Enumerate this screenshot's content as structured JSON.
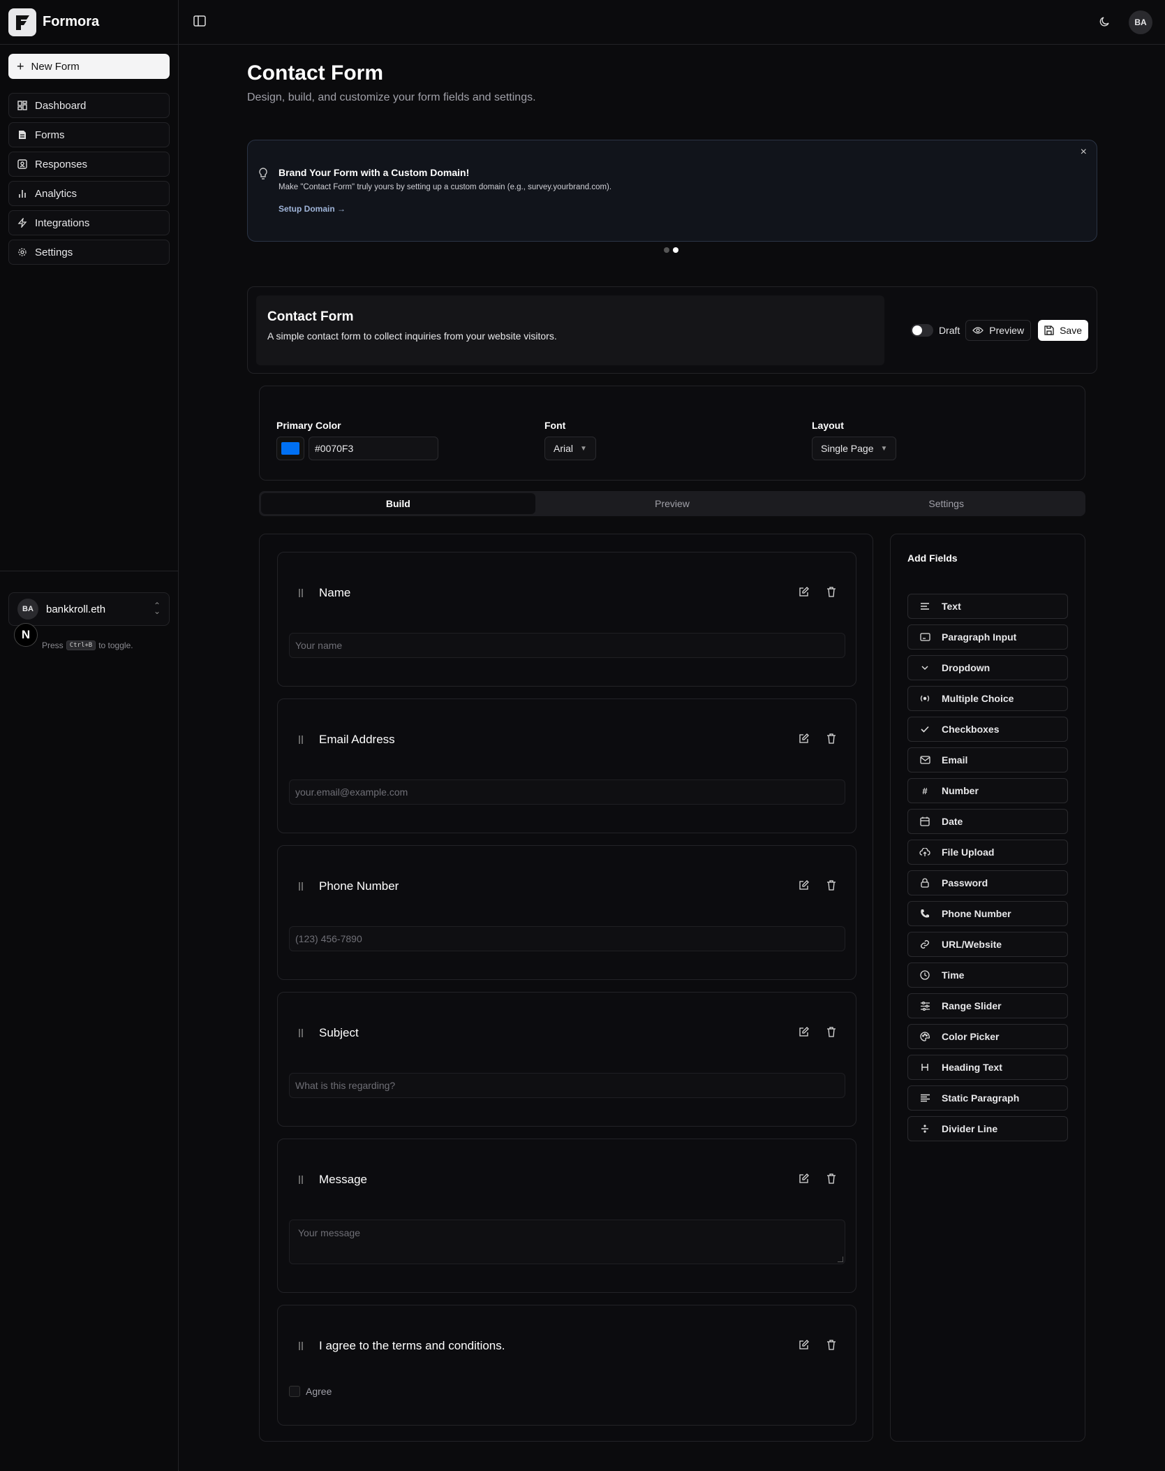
{
  "brand": {
    "name": "Formora"
  },
  "sidebar": {
    "new_form": "New Form",
    "items": [
      {
        "label": "Dashboard",
        "icon": "dashboard-icon"
      },
      {
        "label": "Forms",
        "icon": "file-icon"
      },
      {
        "label": "Responses",
        "icon": "inbox-icon"
      },
      {
        "label": "Analytics",
        "icon": "chart-icon"
      },
      {
        "label": "Integrations",
        "icon": "zap-icon"
      },
      {
        "label": "Settings",
        "icon": "gear-icon"
      }
    ],
    "user": {
      "initials": "BA",
      "name": "bankkroll.eth"
    },
    "hint": {
      "prefix": "Press",
      "key": "Ctrl+B",
      "suffix": "to toggle."
    },
    "n_badge": "N"
  },
  "topbar": {
    "avatar": "BA"
  },
  "page": {
    "title": "Contact Form",
    "subtitle": "Design, build, and customize your form fields and settings."
  },
  "banner": {
    "title": "Brand Your Form with a Custom Domain!",
    "text": "Make \"Contact Form\" truly yours by setting up a custom domain (e.g., survey.yourbrand.com).",
    "link": "Setup Domain →",
    "close": "×"
  },
  "form_header": {
    "title": "Contact Form",
    "description": "A simple contact form to collect inquiries from your website visitors.",
    "draft_label": "Draft",
    "preview_label": "Preview",
    "save_label": "Save"
  },
  "theme": {
    "primary_color_label": "Primary Color",
    "primary_color_value": "#0070F3",
    "font_label": "Font",
    "font_value": "Arial",
    "layout_label": "Layout",
    "layout_value": "Single Page"
  },
  "tabs": [
    {
      "label": "Build",
      "active": true
    },
    {
      "label": "Preview",
      "active": false
    },
    {
      "label": "Settings",
      "active": false
    }
  ],
  "fields": [
    {
      "label": "Name",
      "placeholder": "Your name"
    },
    {
      "label": "Email Address",
      "placeholder": "your.email@example.com"
    },
    {
      "label": "Phone Number",
      "placeholder": "(123) 456-7890"
    },
    {
      "label": "Subject",
      "placeholder": "What is this regarding?"
    },
    {
      "label": "Message",
      "placeholder": "Your message"
    },
    {
      "label": "I agree to the terms and conditions.",
      "option": "Agree"
    }
  ],
  "add_fields": {
    "title": "Add Fields",
    "items": [
      {
        "label": "Text",
        "icon": "text-lines-icon"
      },
      {
        "label": "Paragraph Input",
        "icon": "paragraph-box-icon"
      },
      {
        "label": "Dropdown",
        "icon": "chevron-down-icon"
      },
      {
        "label": "Multiple Choice",
        "icon": "radio-icon"
      },
      {
        "label": "Checkboxes",
        "icon": "check-icon"
      },
      {
        "label": "Email",
        "icon": "mail-icon"
      },
      {
        "label": "Number",
        "icon": "hash-icon"
      },
      {
        "label": "Date",
        "icon": "calendar-icon"
      },
      {
        "label": "File Upload",
        "icon": "upload-cloud-icon"
      },
      {
        "label": "Password",
        "icon": "lock-icon"
      },
      {
        "label": "Phone Number",
        "icon": "phone-icon"
      },
      {
        "label": "URL/Website",
        "icon": "link-icon"
      },
      {
        "label": "Time",
        "icon": "clock-icon"
      },
      {
        "label": "Range Slider",
        "icon": "sliders-icon"
      },
      {
        "label": "Color Picker",
        "icon": "palette-icon"
      },
      {
        "label": "Heading Text",
        "icon": "heading-icon"
      },
      {
        "label": "Static Paragraph",
        "icon": "align-left-icon"
      },
      {
        "label": "Divider Line",
        "icon": "divide-icon"
      }
    ]
  },
  "colors": {
    "primary": "#0070F3",
    "background": "#0b0b0d",
    "border": "#232327"
  }
}
